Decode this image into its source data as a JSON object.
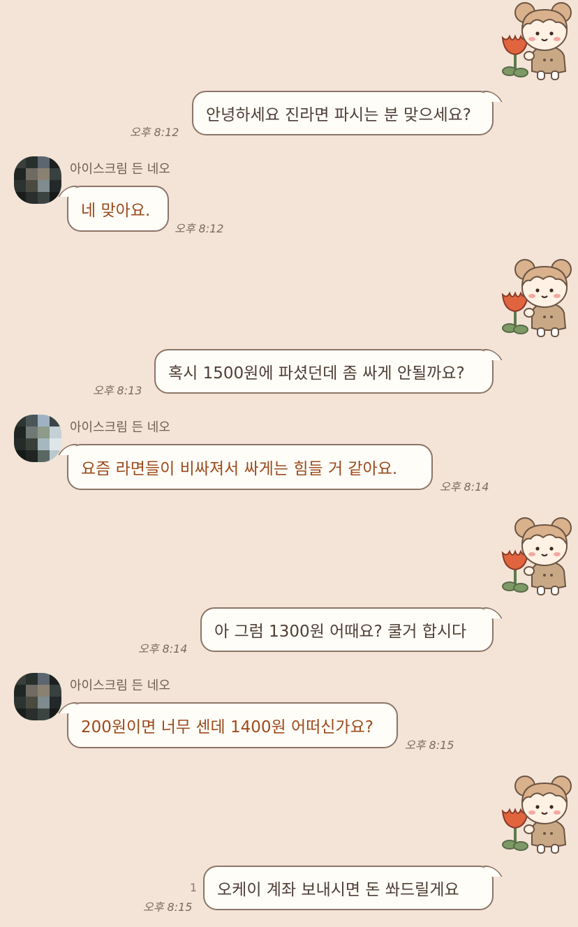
{
  "chat": {
    "messages": [
      {
        "text": "안녕하세요 진라면 파시는 분 맞으세요?",
        "time": "오후 8:12"
      },
      {
        "sender": "아이스크림 든 네오",
        "text": "네 맞아요.",
        "time": "오후 8:12"
      },
      {
        "text": "혹시 1500원에 파셨던데 좀 싸게 안될까요?",
        "time": "오후 8:13"
      },
      {
        "sender": "아이스크림 든 네오",
        "text": "요즘 라면들이 비싸져서 싸게는 힘들 거 같아요.",
        "time": "오후 8:14"
      },
      {
        "text": "아 그럼 1300원 어때요? 쿨거 합시다",
        "time": "오후 8:14"
      },
      {
        "sender": "아이스크림 든 네오",
        "text": "200원이면 너무 센데 1400원 어떠신가요?",
        "time": "오후 8:15"
      },
      {
        "text": "오케이 계좌 보내시면 돈 쏴드릴게요",
        "time": "오후 8:15",
        "unread": "1"
      }
    ]
  },
  "colors": {
    "background": "#f3e4d7",
    "bubble": "#fffdf8",
    "bubble_border": "#8b7566",
    "outgoing_text": "#4e3e34",
    "incoming_text": "#9b4a1c"
  },
  "icons": {
    "sticker": "girl-with-tulip-sticker-icon",
    "avatar": "pixelated-avatar-icon"
  }
}
